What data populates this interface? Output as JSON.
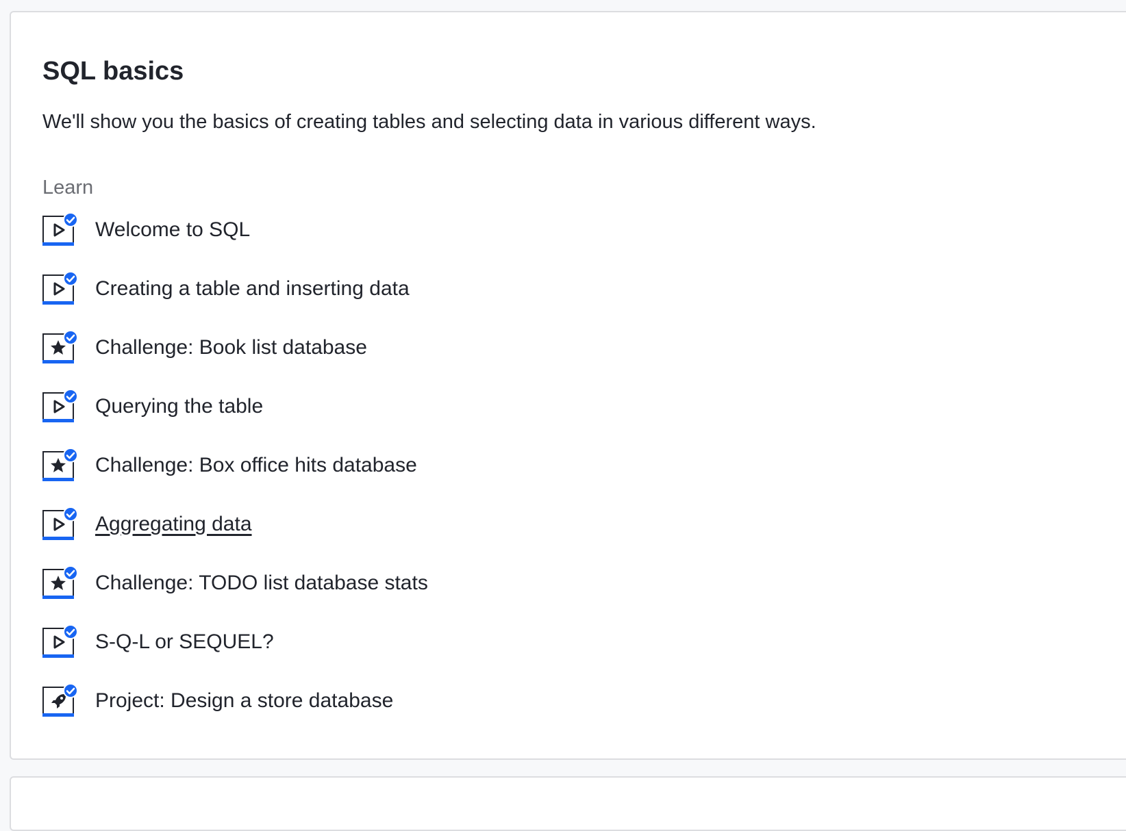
{
  "unit": {
    "title": "SQL basics",
    "description": "We'll show you the basics of creating tables and selecting data in various different ways."
  },
  "section": {
    "label": "Learn"
  },
  "lessons": [
    {
      "label": "Welcome to SQL",
      "icon": "video-icon",
      "completed": true
    },
    {
      "label": "Creating a table and inserting data",
      "icon": "video-icon",
      "completed": true
    },
    {
      "label": "Challenge: Book list database",
      "icon": "challenge-star-icon",
      "completed": true
    },
    {
      "label": "Querying the table",
      "icon": "video-icon",
      "completed": true
    },
    {
      "label": "Challenge: Box office hits database",
      "icon": "challenge-star-icon",
      "completed": true
    },
    {
      "label": "Aggregating data",
      "icon": "video-icon",
      "completed": true,
      "hovered": true
    },
    {
      "label": "Challenge: TODO list database stats",
      "icon": "challenge-star-icon",
      "completed": true
    },
    {
      "label": "S-Q-L or SEQUEL?",
      "icon": "video-icon",
      "completed": true
    },
    {
      "label": "Project: Design a store database",
      "icon": "project-rocket-icon",
      "completed": true
    }
  ],
  "colors": {
    "accent": "#1865f2",
    "text": "#21242c",
    "muted": "#6b6d73",
    "border": "#dcdde0"
  }
}
